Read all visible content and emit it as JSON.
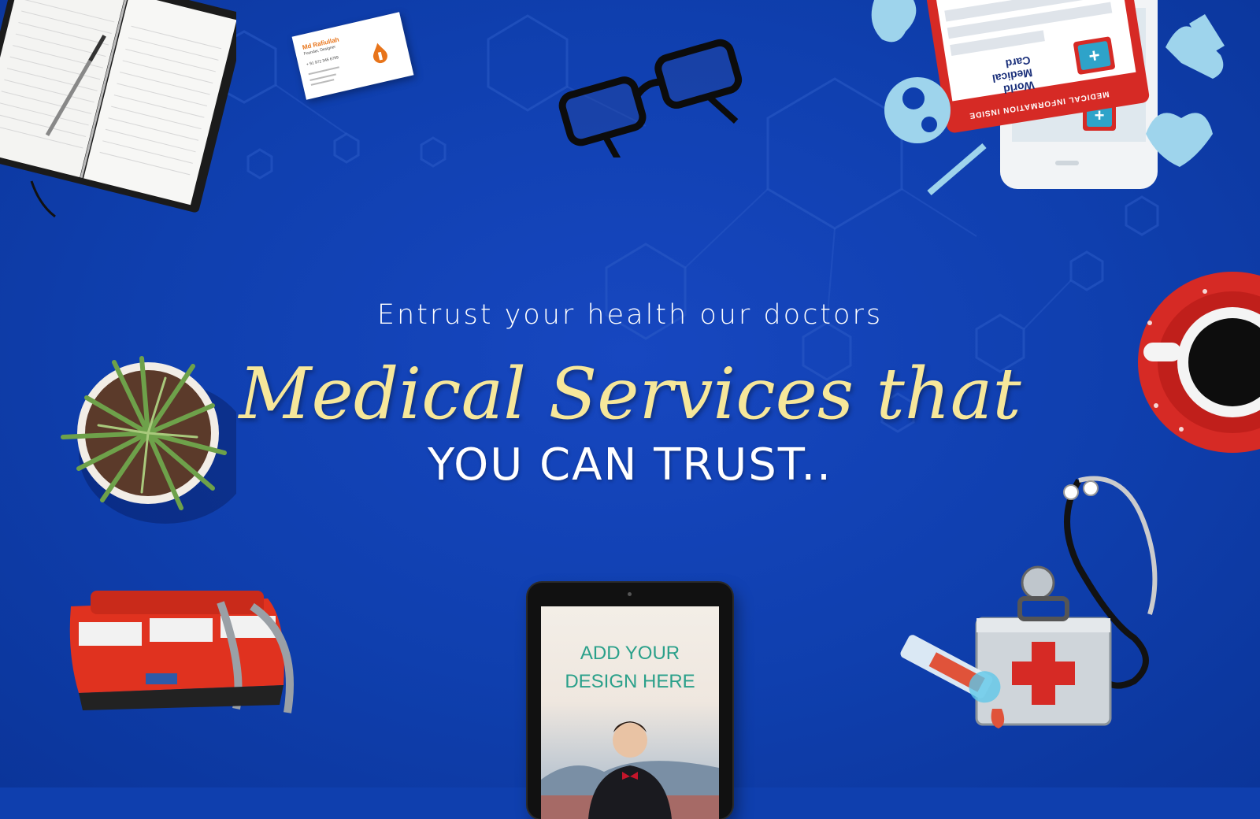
{
  "hero": {
    "tagline": "Entrust your health our doctors",
    "headline": "Medical Services that",
    "subline": "YOU CAN TRUST.."
  },
  "tablet": {
    "line1": "ADD YOUR",
    "line2": "DESIGN HERE"
  },
  "business_card": {
    "name": "Md Rafiullah",
    "role": "Founder, Designer",
    "phone": "+ 91 972 345 6799"
  },
  "medical_card": {
    "title_line1": "World",
    "title_line2": "Medical",
    "title_line3": "Card",
    "footer": "MEDICAL INFORMATION INSIDE"
  },
  "colors": {
    "background": "#0f3fae",
    "headline": "#f6e79a",
    "accent_red": "#d62a25",
    "icon_light": "#9ed4ec"
  }
}
